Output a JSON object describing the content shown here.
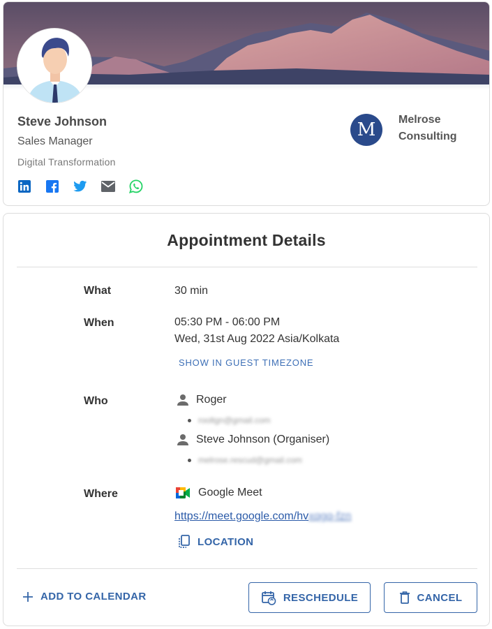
{
  "profile": {
    "name": "Steve Johnson",
    "role": "Sales Manager",
    "department": "Digital Transformation",
    "socials": [
      "linkedin-icon",
      "facebook-icon",
      "twitter-icon",
      "mail-icon",
      "whatsapp-icon"
    ],
    "company": {
      "logo_letter": "M",
      "name": "Melrose Consulting"
    }
  },
  "appointment": {
    "title": "Appointment Details",
    "what_label": "What",
    "what_value": "30 min",
    "when_label": "When",
    "when_time": "05:30 PM - 06:00 PM",
    "when_date": "Wed, 31st Aug 2022 Asia/Kolkata",
    "guest_timezone_label": "SHOW IN GUEST TIMEZONE",
    "who_label": "Who",
    "attendees": [
      {
        "name": "Roger",
        "email": "rooltgn@gmail.com"
      },
      {
        "name": "Steve Johnson (Organiser)",
        "email": "melrose.rescud@gmail.com"
      }
    ],
    "where_label": "Where",
    "location_name": "Google Meet",
    "meet_link_visible": "https://meet.google.com/hv",
    "meet_link_blurred": "xqgq-fzn",
    "location_button": "LOCATION"
  },
  "actions": {
    "add_to_calendar": "ADD TO CALENDAR",
    "reschedule": "RESCHEDULE",
    "cancel": "CANCEL"
  },
  "colors": {
    "accent": "#3465a8",
    "company_logo_bg": "#2a4a8b",
    "linkedin": "#0a66c2",
    "facebook": "#1877f2",
    "twitter": "#1d9bf0",
    "whatsapp": "#25d366"
  }
}
